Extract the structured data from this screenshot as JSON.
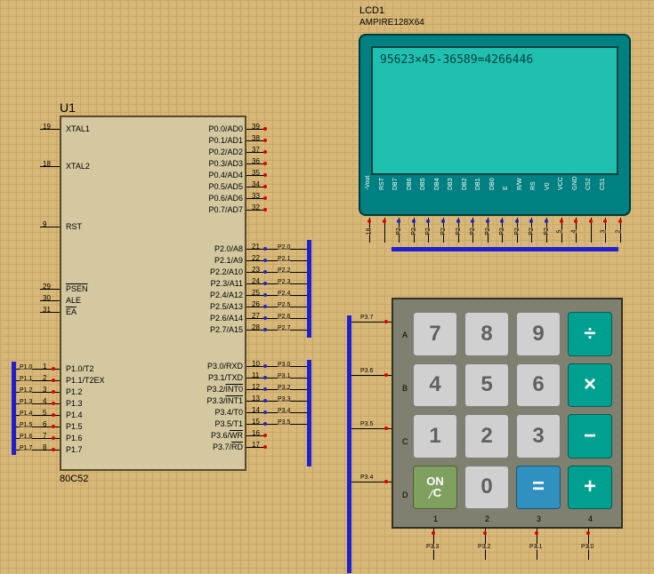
{
  "mcu": {
    "ref": "U1",
    "part": "80C52",
    "left_pins": [
      {
        "name": "XTAL1",
        "num": "19",
        "net": ""
      },
      {
        "name": "XTAL2",
        "num": "18",
        "net": ""
      },
      {
        "name": "RST",
        "num": "9",
        "net": ""
      },
      {
        "name": "PSEN",
        "num": "29",
        "net": "",
        "ov": true
      },
      {
        "name": "ALE",
        "num": "30",
        "net": ""
      },
      {
        "name": "EA",
        "num": "31",
        "net": "",
        "ov": true
      },
      {
        "name": "P1.0/T2",
        "num": "1",
        "net": "P1.0"
      },
      {
        "name": "P1.1/T2EX",
        "num": "2",
        "net": "P1.1"
      },
      {
        "name": "P1.2",
        "num": "3",
        "net": "P1.2"
      },
      {
        "name": "P1.3",
        "num": "4",
        "net": "P1.3"
      },
      {
        "name": "P1.4",
        "num": "5",
        "net": "P1.4"
      },
      {
        "name": "P1.5",
        "num": "6",
        "net": "P1.5"
      },
      {
        "name": "P1.6",
        "num": "7",
        "net": "P1.6"
      },
      {
        "name": "P1.7",
        "num": "8",
        "net": "P1.7"
      }
    ],
    "right_pins": [
      {
        "name": "P0.0/AD0",
        "num": "39",
        "net": ""
      },
      {
        "name": "P0.1/AD1",
        "num": "38",
        "net": ""
      },
      {
        "name": "P0.2/AD2",
        "num": "37",
        "net": ""
      },
      {
        "name": "P0.3/AD3",
        "num": "36",
        "net": ""
      },
      {
        "name": "P0.4/AD4",
        "num": "35",
        "net": ""
      },
      {
        "name": "P0.5/AD5",
        "num": "34",
        "net": ""
      },
      {
        "name": "P0.6/AD6",
        "num": "33",
        "net": ""
      },
      {
        "name": "P0.7/AD7",
        "num": "32",
        "net": ""
      },
      {
        "name": "P2.0/A8",
        "num": "21",
        "net": "P2.0"
      },
      {
        "name": "P2.1/A9",
        "num": "22",
        "net": "P2.1"
      },
      {
        "name": "P2.2/A10",
        "num": "23",
        "net": "P2.2"
      },
      {
        "name": "P2.3/A11",
        "num": "24",
        "net": "P2.3"
      },
      {
        "name": "P2.4/A12",
        "num": "25",
        "net": "P2.4"
      },
      {
        "name": "P2.5/A13",
        "num": "26",
        "net": "P2.5"
      },
      {
        "name": "P2.6/A14",
        "num": "27",
        "net": "P2.6"
      },
      {
        "name": "P2.7/A15",
        "num": "28",
        "net": "P2.7"
      },
      {
        "name": "P3.0/RXD",
        "num": "10",
        "net": "P3.0"
      },
      {
        "name": "P3.1/TXD",
        "num": "11",
        "net": "P3.1"
      },
      {
        "name": "P3.2/INT0",
        "num": "12",
        "net": "P3.2",
        "ov_tail": true
      },
      {
        "name": "P3.3/INT1",
        "num": "13",
        "net": "P3.3",
        "ov_tail": true
      },
      {
        "name": "P3.4/T0",
        "num": "14",
        "net": "P3.4"
      },
      {
        "name": "P3.5/T1",
        "num": "15",
        "net": "P3.5"
      },
      {
        "name": "P3.6/WR",
        "num": "16",
        "net": "",
        "ov_tail": true
      },
      {
        "name": "P3.7/RD",
        "num": "17",
        "net": "",
        "ov_tail": true
      }
    ]
  },
  "lcd": {
    "ref": "LCD1",
    "part": "AMPIRE128X64",
    "display": "95623×45-36589=4266446",
    "pins": [
      "-Vout",
      "RST",
      "DB7",
      "DB6",
      "DB5",
      "DB4",
      "DB3",
      "DB2",
      "DB1",
      "DB0",
      "E",
      "R/W",
      "RS",
      "V0",
      "VCC",
      "GND",
      "CS2",
      "CS1"
    ],
    "nets": [
      "18",
      "",
      "P2",
      "P2",
      "P2",
      "P2",
      "P2",
      "P2",
      "P2",
      "P2",
      "P2",
      "P2",
      "P2",
      "5",
      "4",
      "",
      "3",
      "2"
    ]
  },
  "keypad": {
    "rows": [
      "A",
      "B",
      "C",
      "D"
    ],
    "cols": [
      "1",
      "2",
      "3",
      "4"
    ],
    "row_nets": [
      "P3.7",
      "P3.6",
      "P3.5",
      "P3.4"
    ],
    "col_nets": [
      "P3.3",
      "P3.2",
      "P3.1",
      "P3.0"
    ],
    "keys": [
      {
        "label": "7",
        "type": "num"
      },
      {
        "label": "8",
        "type": "num"
      },
      {
        "label": "9",
        "type": "num"
      },
      {
        "label": "÷",
        "type": "op"
      },
      {
        "label": "4",
        "type": "num"
      },
      {
        "label": "5",
        "type": "num"
      },
      {
        "label": "6",
        "type": "num"
      },
      {
        "label": "×",
        "type": "op"
      },
      {
        "label": "1",
        "type": "num"
      },
      {
        "label": "2",
        "type": "num"
      },
      {
        "label": "3",
        "type": "num"
      },
      {
        "label": "−",
        "type": "op"
      },
      {
        "label": "ON/C",
        "type": "on"
      },
      {
        "label": "0",
        "type": "num"
      },
      {
        "label": "=",
        "type": "eq"
      },
      {
        "label": "+",
        "type": "op"
      }
    ]
  }
}
